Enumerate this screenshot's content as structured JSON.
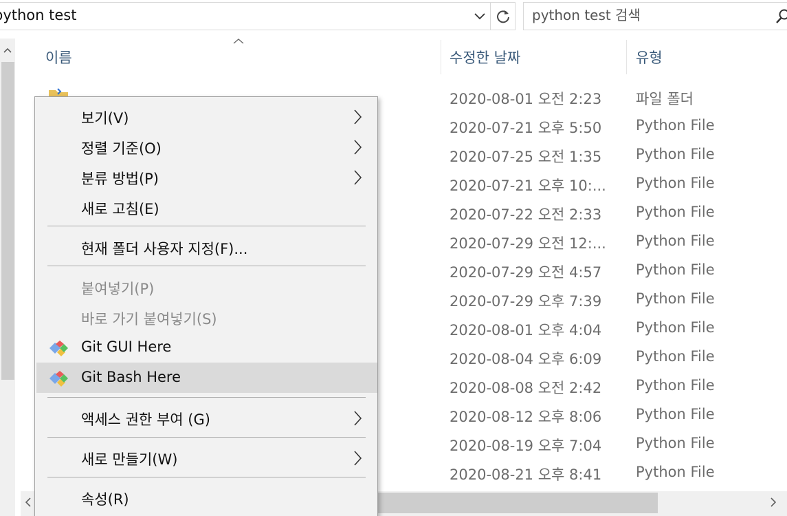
{
  "address_bar": {
    "path": "python test",
    "search_placeholder": "python test 검색"
  },
  "columns": {
    "name": "이름",
    "date_modified": "수정한 날짜",
    "type": "유형"
  },
  "files": [
    {
      "date": "2020-08-01 오전 2:23",
      "type": "파일 폴더"
    },
    {
      "date": "2020-07-21 오후 5:50",
      "type": "Python File"
    },
    {
      "date": "2020-07-25 오전 1:35",
      "type": "Python File"
    },
    {
      "date": "2020-07-21 오후 10:...",
      "type": "Python File"
    },
    {
      "date": "2020-07-22 오전 2:33",
      "type": "Python File"
    },
    {
      "date": "2020-07-29 오전 12:...",
      "type": "Python File"
    },
    {
      "date": "2020-07-29 오전 4:57",
      "type": "Python File"
    },
    {
      "date": "2020-07-29 오후 7:39",
      "type": "Python File"
    },
    {
      "date": "2020-08-01 오후 4:04",
      "type": "Python File"
    },
    {
      "date": "2020-08-04 오후 6:09",
      "type": "Python File"
    },
    {
      "date": "2020-08-08 오전 2:42",
      "type": "Python File"
    },
    {
      "date": "2020-08-12 오후 8:06",
      "type": "Python File"
    },
    {
      "date": "2020-08-19 오후 7:04",
      "type": "Python File"
    },
    {
      "date": "2020-08-21 오후 8:41",
      "type": "Python File"
    }
  ],
  "context_menu": {
    "view": "보기(V)",
    "sort_by": "정렬 기준(O)",
    "group_by": "분류 방법(P)",
    "refresh": "새로 고침(E)",
    "customize_folder": "현재 폴더 사용자 지정(F)...",
    "paste": "붙여넣기(P)",
    "paste_shortcut": "바로 가기 붙여넣기(S)",
    "git_gui": "Git GUI Here",
    "git_bash": "Git Bash Here",
    "give_access": "액세스 권한 부여 (G)",
    "new": "새로 만들기(W)",
    "properties": "속성(R)"
  },
  "colors": {
    "header_text": "#3a5a7a",
    "hover_bg": "#dadada",
    "menu_bg": "#f2f2f2"
  }
}
